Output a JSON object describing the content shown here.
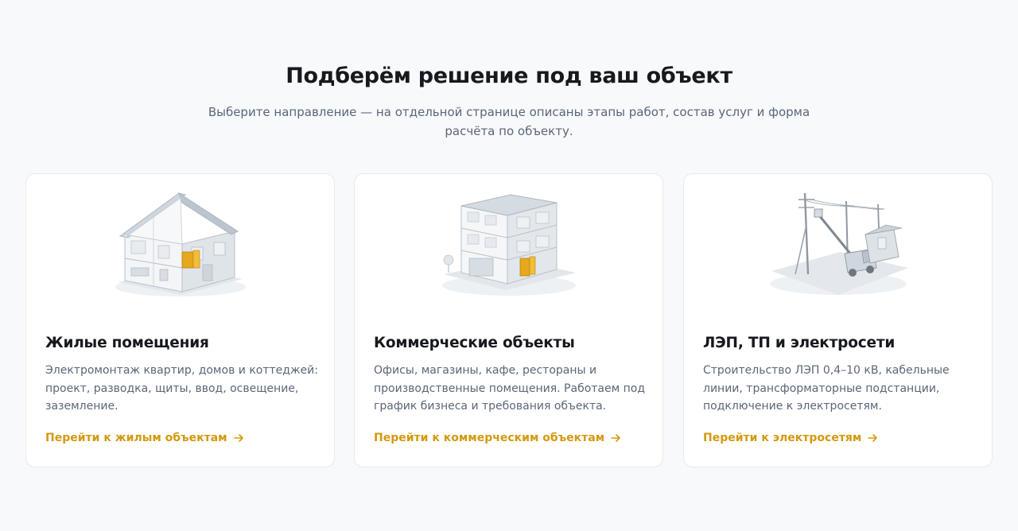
{
  "section": {
    "title": "Подберём решение под ваш объект",
    "subtitle": "Выберите направление — на отдельной странице описаны этапы работ, состав услуг и форма расчёта по объекту."
  },
  "cards": [
    {
      "icon": "residential-house-illustration",
      "title": "Жилые помещения",
      "description": "Электромонтаж квартир, домов и коттеджей: проект, разводка, щиты, ввод, освещение, заземление.",
      "link": "Перейти к жилым объектам"
    },
    {
      "icon": "commercial-building-illustration",
      "title": "Коммерческие объекты",
      "description": "Офисы, магазины, кафе, рестораны и производственные помещения. Работаем под график бизнеса и требования объекта.",
      "link": "Перейти к коммерческим объектам"
    },
    {
      "icon": "power-line-illustration",
      "title": "ЛЭП, ТП и электросети",
      "description": "Строительство ЛЭП 0,4–10 кВ, кабельные линии, трансформаторные подстанции, подключение к электросетям.",
      "link": "Перейти к электросетям"
    }
  ],
  "colors": {
    "accent": "#d39a10",
    "background": "#f8f9fb",
    "card": "#ffffff",
    "muted_text": "#5b6678"
  }
}
